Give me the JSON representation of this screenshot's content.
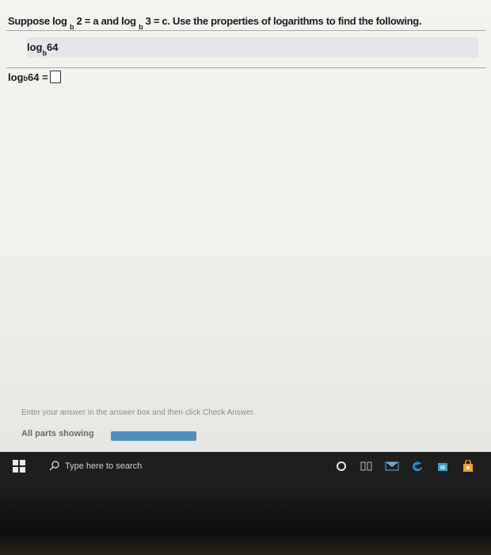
{
  "question": {
    "prefix": "Suppose log",
    "base1": "b",
    "part1": "2 = a and log",
    "base2": "b",
    "part2": "3 = c. Use the properties of logarithms to find the following."
  },
  "subquestion": {
    "prefix": "log",
    "base": "b",
    "arg": "64"
  },
  "answer_row": {
    "prefix": "log",
    "base": "b",
    "arg": "64 ="
  },
  "hint": "Enter your answer in the answer box and then click Check Answer.",
  "parts_label": "All parts showing",
  "progress_fraction": 1.0,
  "taskbar": {
    "search_placeholder": "Type here to search",
    "icons": [
      "windows-start-icon",
      "search-icon",
      "cortana-icon",
      "task-view-icon",
      "mail-icon",
      "edge-icon",
      "store-icon",
      "shopping-bag-icon"
    ]
  },
  "colors": {
    "progress": "#4a90c2",
    "taskbar": "#1e1e1e",
    "edge": "#1f8fd8",
    "store": "#3aa0c8",
    "bag": "#f0a020"
  }
}
